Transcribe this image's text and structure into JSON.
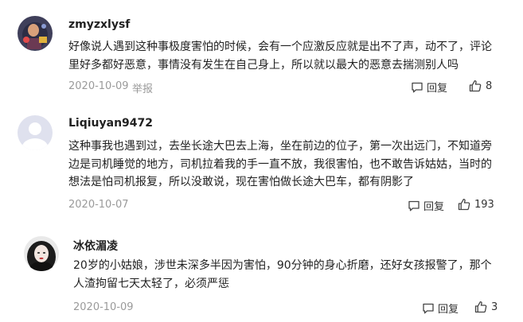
{
  "comments": [
    {
      "username": "zmyzxlysf",
      "lines": [
        "好像说人遇到这种事极度害怕的时候，会有一个应激反应就是出不了声，动不了，评论",
        "里好多都好恶意，事情没有发生在自己身上，所以就以最大的恶意去揣测别人吗"
      ],
      "date": "2020-10-09",
      "report_label": "举报",
      "reply_label": "回复",
      "likes": "8",
      "avatar_icon": "user-photo-avatar"
    },
    {
      "username": "Liqiuyan9472",
      "lines": [
        "这种事我也遇到过，去坐长途大巴去上海，坐在前边的位子，第一次出远门，不知道旁",
        "边是司机睡觉的地方，司机拉着我的手一直不放，我很害怕，也不敢告诉姑姑，当时的",
        "想法是怕司机报复，所以没敢说，现在害怕做长途大巴车，都有阴影了"
      ],
      "date": "2020-10-07",
      "reply_label": "回复",
      "likes": "193",
      "avatar_icon": "default-user-avatar"
    },
    {
      "username": "冰依湄凌",
      "lines": [
        "20岁的小姑娘，涉世未深多半因为害怕，90分钟的身心折磨，还好女孩报警了，那个",
        "人渣拘留七天太轻了，必须严惩"
      ],
      "date": "2020-10-09",
      "reply_label": "回复",
      "likes": "3",
      "avatar_icon": "user-photo-avatar"
    }
  ],
  "colors": {
    "text": "#222222",
    "meta": "#9a9a9a",
    "action": "#333333",
    "default_avatar_bg": "#dfe1ee",
    "default_avatar_fg": "#ffffff"
  }
}
